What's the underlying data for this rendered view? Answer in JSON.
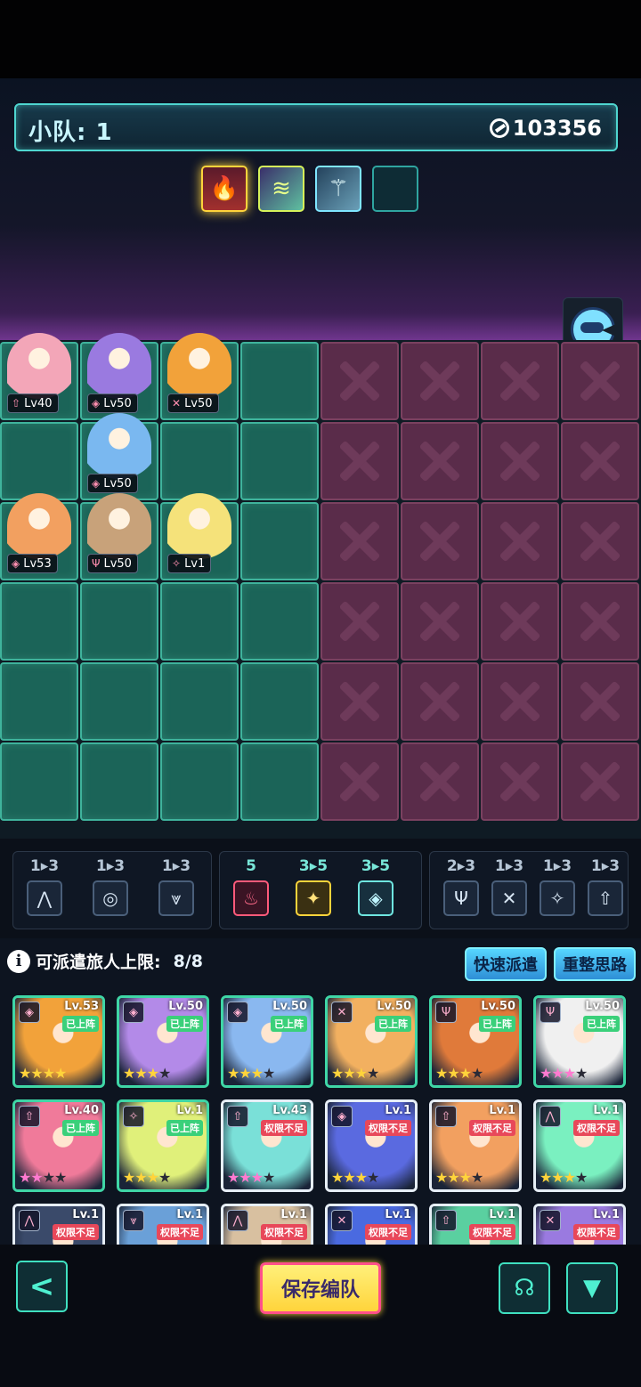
{
  "squad": {
    "title": "小队: 1",
    "power": "103356"
  },
  "relics": [
    {
      "icon": "fire-relic-icon",
      "glyph": "🔥"
    },
    {
      "icon": "wings-relic-icon",
      "glyph": "≋"
    },
    {
      "icon": "staff-relic-icon",
      "glyph": "⚚"
    },
    {
      "icon": "empty-slot",
      "glyph": ""
    }
  ],
  "ai_button_icon": "ai-face-icon",
  "board": {
    "ally_color": "#1b6458",
    "enemy_color": "#5a2c4a",
    "units": [
      {
        "name": "pink-bunny",
        "level": "Lv40",
        "class": "⇧",
        "color": "#f3a6b8"
      },
      {
        "name": "purple-fox",
        "level": "Lv50",
        "class": "◈",
        "color": "#9a7ae0"
      },
      {
        "name": "orange-bear",
        "level": "Lv50",
        "class": "✕",
        "color": "#f2a23a"
      },
      {
        "name": "blue-mermaid",
        "level": "Lv50",
        "class": "◈",
        "color": "#7ab8f0"
      },
      {
        "name": "orange-fox",
        "level": "Lv53",
        "class": "◈",
        "color": "#f2a060"
      },
      {
        "name": "goggles-girl",
        "level": "Lv50",
        "class": "Ψ",
        "color": "#c8a27a"
      },
      {
        "name": "blonde-angel",
        "level": "Lv1",
        "class": "✧",
        "color": "#f5e27a"
      }
    ]
  },
  "synergies": {
    "left": [
      {
        "count": "1▸3",
        "glyph": "⋀",
        "active": false
      },
      {
        "count": "1▸3",
        "glyph": "◎",
        "active": false
      },
      {
        "count": "1▸3",
        "glyph": "⩔",
        "active": false
      }
    ],
    "center": [
      {
        "count": "5",
        "glyph": "♨",
        "style": "red",
        "active": true
      },
      {
        "count": "3▸5",
        "glyph": "✦",
        "style": "gold",
        "active": true
      },
      {
        "count": "3▸5",
        "glyph": "◈",
        "style": "teal",
        "active": true
      }
    ],
    "right": [
      {
        "count": "2▸3",
        "glyph": "Ψ",
        "active": false
      },
      {
        "count": "1▸3",
        "glyph": "✕",
        "active": false
      },
      {
        "count": "1▸3",
        "glyph": "✧",
        "active": false
      },
      {
        "count": "1▸3",
        "glyph": "⇧",
        "active": false
      }
    ]
  },
  "roster": {
    "label": "可派遣旅人上限:",
    "count": "8/8",
    "quick_dispatch": "快速派遣",
    "reset_plan": "重整思路",
    "cards": [
      {
        "level": "Lv.53",
        "tag": "已上阵",
        "tag_type": "on",
        "class": "◈",
        "color": "#f2a23a",
        "stars": 4,
        "pink": false
      },
      {
        "level": "Lv.50",
        "tag": "已上阵",
        "tag_type": "on",
        "class": "◈",
        "color": "#b38ae8",
        "stars": 3,
        "pink": false
      },
      {
        "level": "Lv.50",
        "tag": "已上阵",
        "tag_type": "on",
        "class": "◈",
        "color": "#8ab8f0",
        "stars": 3,
        "pink": false
      },
      {
        "level": "Lv.50",
        "tag": "已上阵",
        "tag_type": "on",
        "class": "✕",
        "color": "#f2b060",
        "stars": 3,
        "pink": false
      },
      {
        "level": "Lv.50",
        "tag": "已上阵",
        "tag_type": "on",
        "class": "Ψ",
        "color": "#e07a3a",
        "stars": 3,
        "pink": false
      },
      {
        "level": "Lv.50",
        "tag": "已上阵",
        "tag_type": "on",
        "class": "Ψ",
        "color": "#f0f0f0",
        "stars": 3,
        "pink": true
      },
      {
        "level": "Lv.40",
        "tag": "已上阵",
        "tag_type": "on",
        "class": "⇧",
        "color": "#f07a9a",
        "stars": 2,
        "pink": true
      },
      {
        "level": "Lv.1",
        "tag": "已上阵",
        "tag_type": "on",
        "class": "✧",
        "color": "#e0f07a",
        "stars": 3,
        "pink": false
      },
      {
        "level": "Lv.43",
        "tag": "权限不足",
        "tag_type": "lock",
        "class": "⇧",
        "color": "#7ae0d8",
        "stars": 3,
        "pink": true
      },
      {
        "level": "Lv.1",
        "tag": "权限不足",
        "tag_type": "lock",
        "class": "◈",
        "color": "#5a6ae0",
        "stars": 3,
        "pink": false
      },
      {
        "level": "Lv.1",
        "tag": "权限不足",
        "tag_type": "lock",
        "class": "⇧",
        "color": "#f2a060",
        "stars": 3,
        "pink": false
      },
      {
        "level": "Lv.1",
        "tag": "权限不足",
        "tag_type": "lock",
        "class": "⋀",
        "color": "#7af0c0",
        "stars": 3,
        "pink": false
      },
      {
        "level": "Lv.1",
        "tag": "权限不足",
        "tag_type": "lock",
        "class": "⋀",
        "color": "#3a4a6a",
        "stars": 0,
        "pink": false
      },
      {
        "level": "Lv.1",
        "tag": "权限不足",
        "tag_type": "lock",
        "class": "⩔",
        "color": "#6aa0d8",
        "stars": 0,
        "pink": false
      },
      {
        "level": "Lv.1",
        "tag": "权限不足",
        "tag_type": "lock",
        "class": "⋀",
        "color": "#d8c0a0",
        "stars": 0,
        "pink": false
      },
      {
        "level": "Lv.1",
        "tag": "权限不足",
        "tag_type": "lock",
        "class": "✕",
        "color": "#4a6ae0",
        "stars": 0,
        "pink": false
      },
      {
        "level": "Lv.1",
        "tag": "权限不足",
        "tag_type": "lock",
        "class": "⇧",
        "color": "#5ad0a0",
        "stars": 0,
        "pink": false
      },
      {
        "level": "Lv.1",
        "tag": "权限不足",
        "tag_type": "lock",
        "class": "✕",
        "color": "#9a7ae0",
        "stars": 0,
        "pink": false
      }
    ]
  },
  "footer": {
    "back_glyph": "<",
    "save_label": "保存编队",
    "brain_glyph": "☊",
    "filter_glyph": "▼"
  }
}
